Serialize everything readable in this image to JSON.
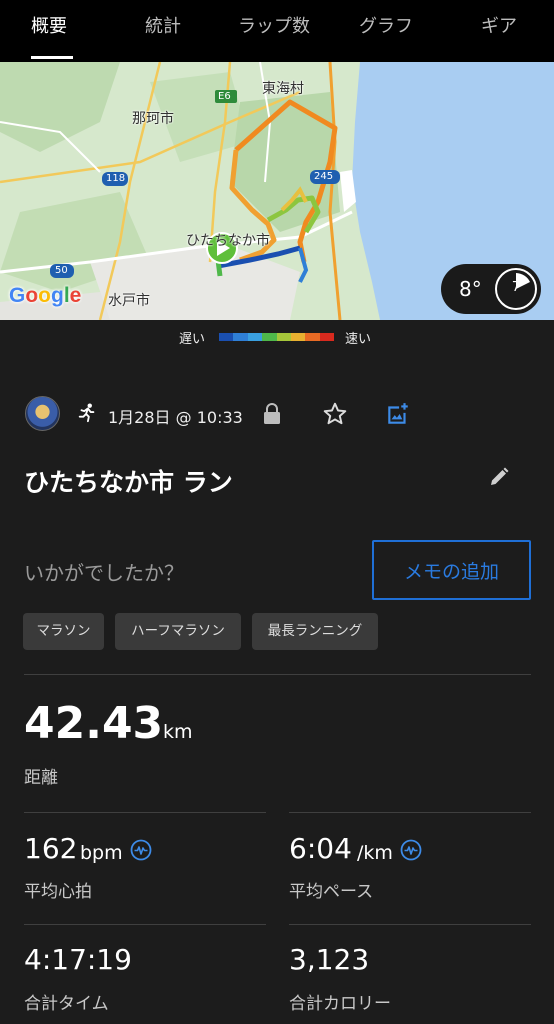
{
  "tabs": [
    {
      "label": "概要",
      "active": true
    },
    {
      "label": "統計",
      "active": false
    },
    {
      "label": "ラップ数",
      "active": false
    },
    {
      "label": "グラフ",
      "active": false
    },
    {
      "label": "ギア",
      "active": false
    }
  ],
  "map": {
    "labels": {
      "tokai": "東海村",
      "naka": "那珂市",
      "hitachinaka": "ひたちなか市",
      "mito": "水戸市",
      "road_e6": "E6",
      "road_118": "118",
      "road_245": "245",
      "road_50": "50"
    },
    "google_logo": "Google",
    "weather": {
      "temperature": "8°",
      "dial_value": "7"
    }
  },
  "speed_legend": {
    "slow": "遅い",
    "fast": "速い",
    "colors": [
      "#1a4fb0",
      "#2f7fd6",
      "#3aa0e0",
      "#4fb84a",
      "#a6c63a",
      "#e8b030",
      "#e86a24",
      "#d82a1e"
    ]
  },
  "activity": {
    "date": "1月28日 @ 10:33",
    "title": "ひたちなか市 ラン",
    "prompt": "いかがでしたか？",
    "memo_button": "メモの追加",
    "tags": [
      "マラソン",
      "ハーフマラソン",
      "最長ランニング"
    ]
  },
  "stats": {
    "distance": {
      "value": "42.43",
      "unit": "km",
      "label": "距離"
    },
    "avg_hr": {
      "value": "162",
      "unit": "bpm",
      "label": "平均心拍"
    },
    "avg_pace": {
      "value": "6:04",
      "unit": "/km",
      "label": "平均ペース"
    },
    "total_time": {
      "value": "4:17:19",
      "label": "合計タイム"
    },
    "calories": {
      "value": "3,123",
      "label": "合計カロリー"
    }
  },
  "icons": {
    "run": "running-person-icon",
    "lock": "lock-icon",
    "star": "star-icon",
    "add_photo": "add-photo-icon",
    "edit": "pencil-icon",
    "heart_rate": "heart-rate-icon"
  },
  "colors": {
    "accent": "#1f6fd6",
    "background": "#1c1c1c",
    "water": "#a9cdf2"
  }
}
